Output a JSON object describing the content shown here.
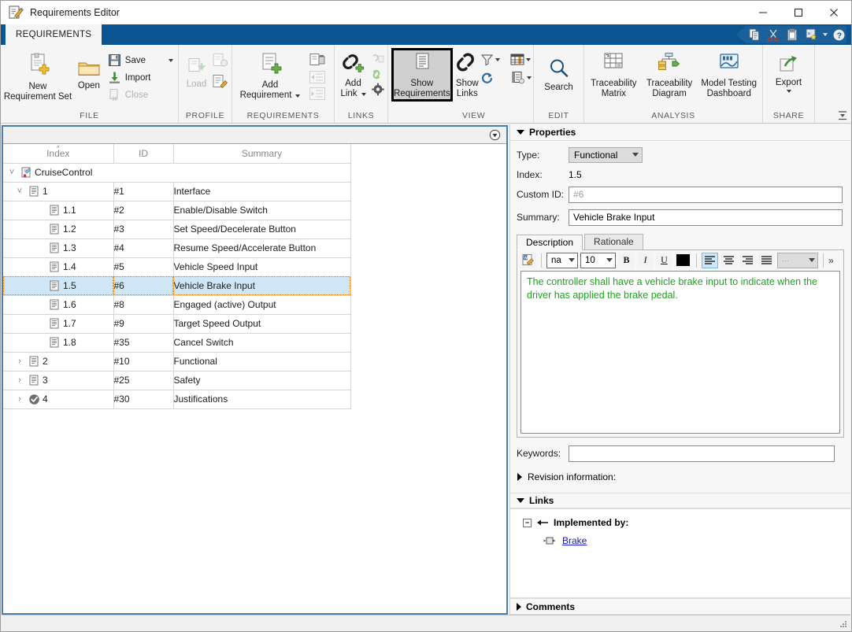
{
  "window": {
    "title": "Requirements Editor",
    "icon": "requirements-editor-icon",
    "minimize": "—",
    "maximize": "☐",
    "close": "✕"
  },
  "quick_access": [
    {
      "name": "copy-icon"
    },
    {
      "name": "cut-icon"
    },
    {
      "name": "paste-icon"
    },
    {
      "name": "customize-qat-icon"
    },
    {
      "name": "chevron-down-icon"
    },
    {
      "name": "help-icon"
    }
  ],
  "ribbon": {
    "tabs": [
      {
        "label": "REQUIREMENTS",
        "active": true
      }
    ],
    "groups": [
      {
        "label": "FILE",
        "big": [
          {
            "label": "New\nRequirement Set",
            "label_line1": "New",
            "label_line2": "Requirement Set",
            "icon": "new-requirement-set-icon",
            "enabled": true
          },
          {
            "label": "Open",
            "label_line1": "Open",
            "label_line2": "",
            "icon": "open-folder-icon",
            "enabled": true
          }
        ],
        "small": [
          {
            "label": "Save",
            "icon": "save-icon",
            "enabled": true,
            "dropdown": true
          },
          {
            "label": "Import",
            "icon": "import-icon",
            "enabled": true,
            "dropdown": false
          },
          {
            "label": "Close",
            "icon": "close-file-icon",
            "enabled": false,
            "dropdown": false
          }
        ]
      },
      {
        "label": "PROFILE",
        "big": [
          {
            "label_line1": "Load",
            "label_line2": "",
            "icon": "load-profile-icon",
            "enabled": false
          }
        ],
        "icons": [
          {
            "name": "profile-settings-icon",
            "enabled": false
          },
          {
            "name": "profile-edit-icon",
            "enabled": true
          }
        ]
      },
      {
        "label": "REQUIREMENTS",
        "big": [
          {
            "label_line1": "Add",
            "label_line2": "Requirement",
            "icon": "add-requirement-icon",
            "enabled": true,
            "dropdown": true
          }
        ],
        "icons": [
          {
            "name": "delete-requirement-icon",
            "enabled": true
          },
          {
            "name": "promote-requirement-icon",
            "enabled": false
          },
          {
            "name": "demote-requirement-icon",
            "enabled": false
          }
        ]
      },
      {
        "label": "LINKS",
        "big": [
          {
            "label_line1": "Add",
            "label_line2": "Link",
            "icon": "add-link-icon",
            "enabled": true,
            "dropdown": true
          }
        ],
        "icons": [
          {
            "name": "delete-link-icon",
            "enabled": false
          },
          {
            "name": "link-settings-icon",
            "enabled": true
          },
          {
            "name": "gear-icon",
            "enabled": true
          }
        ]
      },
      {
        "label": "VIEW",
        "big": [
          {
            "label_line1": "Show",
            "label_line2": "Requirements",
            "icon": "show-requirements-icon",
            "enabled": true,
            "selected": true
          },
          {
            "label_line1": "Show",
            "label_line2": "Links",
            "icon": "show-links-icon",
            "enabled": true
          }
        ],
        "icons": [
          {
            "name": "filter-icon",
            "enabled": true,
            "dropdown": true
          },
          {
            "name": "refresh-icon",
            "enabled": true
          },
          {
            "name": "columns-icon",
            "enabled": true,
            "dropdown": true
          },
          {
            "name": "report-icon",
            "enabled": true,
            "dropdown": true
          }
        ]
      },
      {
        "label": "EDIT",
        "big": [
          {
            "label_line1": "Search",
            "label_line2": "",
            "icon": "search-icon",
            "enabled": true
          }
        ]
      },
      {
        "label": "ANALYSIS",
        "big": [
          {
            "label_line1": "Traceability",
            "label_line2": "Matrix",
            "icon": "traceability-matrix-icon",
            "enabled": true
          },
          {
            "label_line1": "Traceability",
            "label_line2": "Diagram",
            "icon": "traceability-diagram-icon",
            "enabled": true
          },
          {
            "label_line1": "Model Testing",
            "label_line2": "Dashboard",
            "icon": "model-testing-dashboard-icon",
            "enabled": true
          }
        ]
      },
      {
        "label": "SHARE",
        "big": [
          {
            "label_line1": "Export",
            "label_line2": "",
            "icon": "export-icon",
            "enabled": true,
            "dropdown": true
          }
        ]
      }
    ]
  },
  "table": {
    "columns": [
      "Index",
      "ID",
      "Summary"
    ],
    "sorted_column": "Index",
    "set_row": {
      "index": "CruiseControl",
      "id": "",
      "summary": "",
      "icon": "requirement-set-icon",
      "expanded": true
    },
    "rows": [
      {
        "index": "1",
        "id": "#1",
        "summary": "Interface",
        "level": 1,
        "icon": "requirement-icon",
        "expandable": true,
        "expanded": true,
        "selected": false
      },
      {
        "index": "1.1",
        "id": "#2",
        "summary": "Enable/Disable Switch",
        "level": 2,
        "icon": "requirement-icon",
        "expandable": false,
        "expanded": false,
        "selected": false
      },
      {
        "index": "1.2",
        "id": "#3",
        "summary": "Set Speed/Decelerate Button",
        "level": 2,
        "icon": "requirement-icon",
        "expandable": false,
        "expanded": false,
        "selected": false
      },
      {
        "index": "1.3",
        "id": "#4",
        "summary": "Resume Speed/Accelerate Button",
        "level": 2,
        "icon": "requirement-icon",
        "expandable": false,
        "expanded": false,
        "selected": false
      },
      {
        "index": "1.4",
        "id": "#5",
        "summary": "Vehicle Speed Input",
        "level": 2,
        "icon": "requirement-icon",
        "expandable": false,
        "expanded": false,
        "selected": false
      },
      {
        "index": "1.5",
        "id": "#6",
        "summary": "Vehicle Brake Input",
        "level": 2,
        "icon": "requirement-icon",
        "expandable": false,
        "expanded": false,
        "selected": true
      },
      {
        "index": "1.6",
        "id": "#8",
        "summary": "Engaged (active) Output",
        "level": 2,
        "icon": "requirement-icon",
        "expandable": false,
        "expanded": false,
        "selected": false
      },
      {
        "index": "1.7",
        "id": "#9",
        "summary": "Target Speed Output",
        "level": 2,
        "icon": "requirement-icon",
        "expandable": false,
        "expanded": false,
        "selected": false
      },
      {
        "index": "1.8",
        "id": "#35",
        "summary": "Cancel Switch",
        "level": 2,
        "icon": "requirement-icon",
        "expandable": false,
        "expanded": false,
        "selected": false
      },
      {
        "index": "2",
        "id": "#10",
        "summary": "Functional",
        "level": 1,
        "icon": "requirement-icon",
        "expandable": true,
        "expanded": false,
        "selected": false
      },
      {
        "index": "3",
        "id": "#25",
        "summary": "Safety",
        "level": 1,
        "icon": "requirement-icon",
        "expandable": true,
        "expanded": false,
        "selected": false
      },
      {
        "index": "4",
        "id": "#30",
        "summary": "Justifications",
        "level": 1,
        "icon": "justification-icon",
        "expandable": true,
        "expanded": false,
        "selected": false
      }
    ],
    "toolbar": {
      "dropdown_icon": "view-options-icon"
    }
  },
  "properties": {
    "header": "Properties",
    "expanded": true,
    "type_label": "Type:",
    "type_value": "Functional",
    "index_label": "Index:",
    "index_value": "1.5",
    "custom_id_label": "Custom ID:",
    "custom_id_value": "",
    "custom_id_placeholder": "#6",
    "summary_label": "Summary:",
    "summary_value": "Vehicle Brake Input",
    "tabs": [
      {
        "label": "Description",
        "active": true
      },
      {
        "label": "Rationale",
        "active": false
      }
    ],
    "rich_toolbar": {
      "word_icon": "open-in-word-icon",
      "font_family": "na",
      "font_size": "10",
      "bold": "B",
      "italic": "I",
      "underline": "U",
      "color_swatch": "#000000",
      "align_left": "align-left-icon",
      "align_center": "align-center-icon",
      "align_right": "align-right-icon",
      "align_justify": "align-justify-icon",
      "list_value": "···",
      "overflow": "»"
    },
    "description_text": "The controller shall have a vehicle brake input to indicate when the driver has applied the brake pedal.",
    "description_color": "#22a022",
    "keywords_label": "Keywords:",
    "keywords_value": "",
    "revision_label": "Revision information:",
    "revision_expanded": false
  },
  "links": {
    "header": "Links",
    "expanded": true,
    "group_label": "Implemented by:",
    "group_icon": "left-arrow-icon",
    "group_expanded": true,
    "items": [
      {
        "label": "Brake",
        "icon": "simulink-block-icon"
      }
    ]
  },
  "comments": {
    "header": "Comments",
    "expanded": false
  },
  "colors": {
    "ribbon_tab_bar": "#0a5591",
    "selection_fill": "#cfe6f7",
    "selection_border": "#e8820c",
    "pane_focus_border": "#4a7eab",
    "link_text": "#1515c8",
    "description_text": "#22a022"
  }
}
